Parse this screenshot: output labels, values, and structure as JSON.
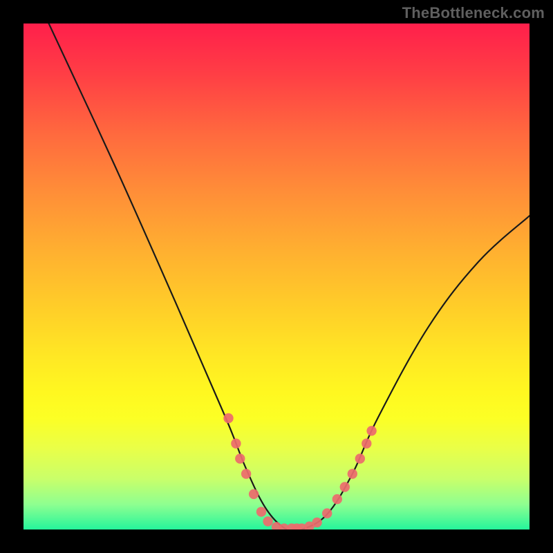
{
  "watermark": "TheBottleneck.com",
  "colors": {
    "frame": "#000000",
    "curve_stroke": "#1a1a1a",
    "marker_fill": "#ed6a6d",
    "watermark_text": "#5f5f5f",
    "gradient_top": "#ff1f4b",
    "gradient_bottom": "#25f59b"
  },
  "chart_data": {
    "type": "line",
    "title": "",
    "xlabel": "",
    "ylabel": "",
    "xlim": [
      0,
      100
    ],
    "ylim": [
      0,
      100
    ],
    "grid": false,
    "legend": false,
    "note": "No numeric axis ticks or labels are rendered; values are read from pixel geometry on a normalized 0–100 × 0–100 space.",
    "series": [
      {
        "name": "curve",
        "x": [
          5,
          18,
          30,
          40,
          44,
          48,
          52,
          55,
          60,
          65,
          70,
          80,
          90,
          100
        ],
        "y": [
          100,
          72,
          45,
          22,
          12,
          4,
          0,
          0,
          3,
          11,
          22,
          40,
          53,
          62
        ]
      }
    ],
    "markers": [
      {
        "x": 40.5,
        "y": 22
      },
      {
        "x": 42.0,
        "y": 17
      },
      {
        "x": 42.8,
        "y": 14
      },
      {
        "x": 44.0,
        "y": 11
      },
      {
        "x": 45.5,
        "y": 7
      },
      {
        "x": 47.0,
        "y": 3.5
      },
      {
        "x": 48.3,
        "y": 1.6
      },
      {
        "x": 50.0,
        "y": 0.5
      },
      {
        "x": 51.5,
        "y": 0.2
      },
      {
        "x": 53.0,
        "y": 0.2
      },
      {
        "x": 54.0,
        "y": 0.2
      },
      {
        "x": 55.0,
        "y": 0.2
      },
      {
        "x": 56.5,
        "y": 0.6
      },
      {
        "x": 58.0,
        "y": 1.4
      },
      {
        "x": 60.0,
        "y": 3.2
      },
      {
        "x": 62.0,
        "y": 6.0
      },
      {
        "x": 63.5,
        "y": 8.4
      },
      {
        "x": 65.0,
        "y": 11.0
      },
      {
        "x": 66.5,
        "y": 14.0
      },
      {
        "x": 67.8,
        "y": 17.0
      },
      {
        "x": 68.8,
        "y": 19.5
      }
    ]
  }
}
